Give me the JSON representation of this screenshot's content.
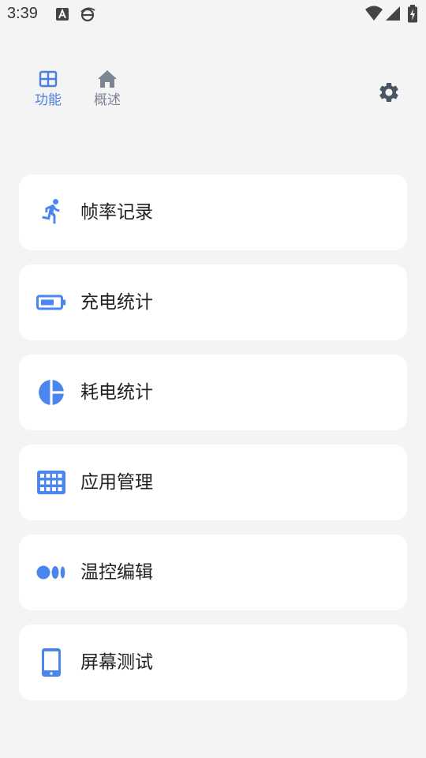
{
  "status_bar": {
    "time": "3:39",
    "notifications": [
      "translate-icon",
      "browser-icon"
    ],
    "indicators": [
      "wifi-icon",
      "cellular-signal-icon",
      "battery-charging-icon"
    ]
  },
  "nav": {
    "tabs": [
      {
        "label": "功能",
        "icon": "grid-icon",
        "active": true
      },
      {
        "label": "概述",
        "icon": "home-icon",
        "active": false
      }
    ],
    "settings_icon": "gear-icon"
  },
  "colors": {
    "accent": "#4a7fe0",
    "icon_blue": "#4a86f0",
    "inactive": "#7b8594",
    "background": "#f4f4f4",
    "card": "#ffffff"
  },
  "features": [
    {
      "label": "帧率记录",
      "icon": "running-person-icon"
    },
    {
      "label": "充电统计",
      "icon": "battery-icon"
    },
    {
      "label": "耗电统计",
      "icon": "pie-chart-icon"
    },
    {
      "label": "应用管理",
      "icon": "app-grid-icon"
    },
    {
      "label": "温控编辑",
      "icon": "dots-icon"
    },
    {
      "label": "屏幕测试",
      "icon": "phone-icon"
    }
  ]
}
